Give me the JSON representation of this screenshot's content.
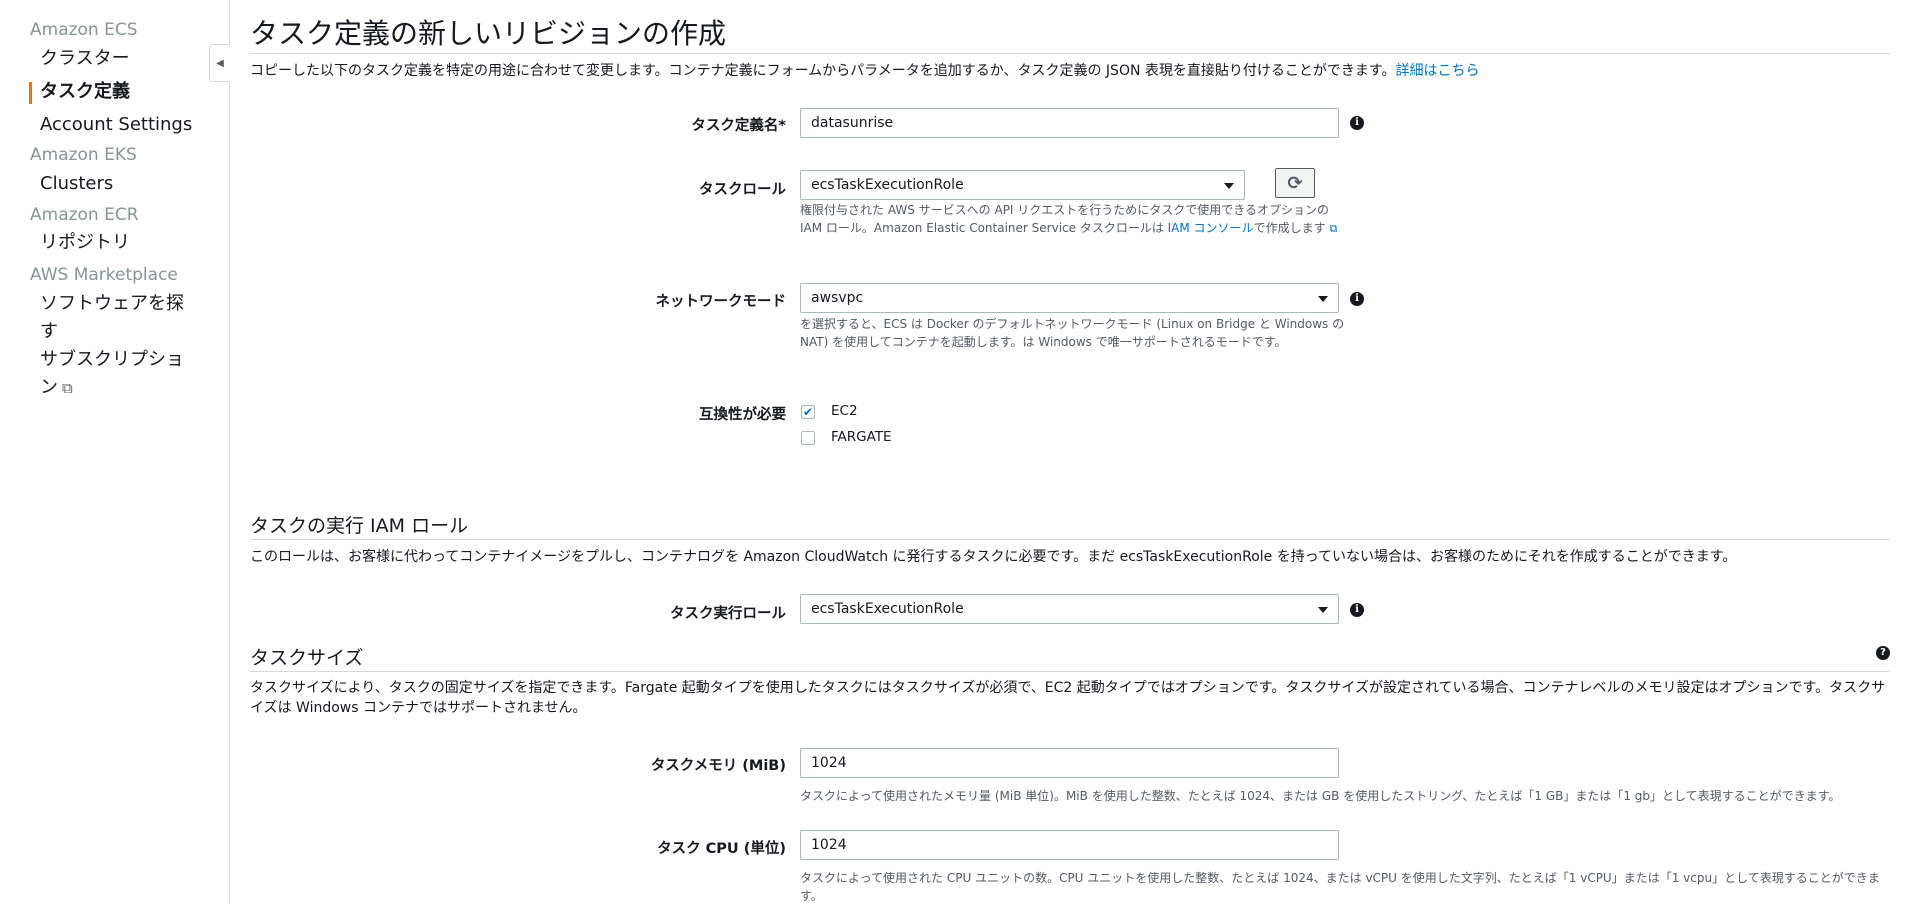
{
  "sidebar": {
    "sections": [
      {
        "title": "Amazon ECS",
        "items": [
          "クラスター",
          "タスク定義",
          "Account Settings"
        ]
      },
      {
        "title": "Amazon EKS",
        "items": [
          "Clusters"
        ]
      },
      {
        "title": "Amazon ECR",
        "items": [
          "リポジトリ"
        ]
      },
      {
        "title": "AWS Marketplace",
        "items": [
          "ソフトウェアを探す",
          "サブスクリプション"
        ]
      }
    ],
    "active_item": "タスク定義"
  },
  "page": {
    "title": "タスク定義の新しいリビジョンの作成",
    "description": "コピーした以下のタスク定義を特定の用途に合わせて変更します。コンテナ定義にフォームからパラメータを追加するか、タスク定義の JSON 表現を直接貼り付けることができます。",
    "learn_more": "詳細はこちら"
  },
  "form": {
    "task_def_name": {
      "label": "タスク定義名*",
      "value": "datasunrise"
    },
    "task_role": {
      "label": "タスクロール",
      "value": "ecsTaskExecutionRole",
      "help_line1": "権限付与された AWS サービスへの API リクエストを行うためにタスクで使用できるオプションの",
      "help_line2_prefix": "IAM ロール。Amazon Elastic Container Service タスクロールは ",
      "help_link": "IAM コンソール",
      "help_line2_suffix": "で作成します"
    },
    "network_mode": {
      "label": "ネットワークモード",
      "value": "awsvpc",
      "help_line1": "を選択すると、ECS は Docker のデフォルトネットワークモード (Linux on Bridge と Windows の",
      "help_line2": "NAT) を使用してコンテナを起動します。は Windows で唯一サポートされるモードです。"
    },
    "compatibility": {
      "label": "互換性が必要",
      "options": [
        {
          "label": "EC2",
          "checked": true
        },
        {
          "label": "FARGATE",
          "checked": false
        }
      ]
    }
  },
  "execution_role": {
    "title": "タスクの実行 IAM ロール",
    "description": "このロールは、お客様に代わってコンテナイメージをプルし、コンテナログを Amazon CloudWatch に発行するタスクに必要です。まだ ecsTaskExecutionRole を持っていない場合は、お客様のためにそれを作成することができます。",
    "label": "タスク実行ロール",
    "value": "ecsTaskExecutionRole"
  },
  "task_size": {
    "title": "タスクサイズ",
    "description_line1": "タスクサイズにより、タスクの固定サイズを指定できます。Fargate 起動タイプを使用したタスクにはタスクサイズが必須で、EC2 起動タイプではオプションです。タスクサイズが設定されている場合、コンテナレベルのメモリ設定はオプションです。タスクサ",
    "description_line2": "イズは Windows コンテナではサポートされません。",
    "memory": {
      "label": "タスクメモリ (MiB)",
      "value": "1024",
      "help": "タスクによって使用されたメモリ量 (MiB 単位)。MiB を使用した整数、たとえば 1024、または GB を使用したストリング、たとえば「1 GB」または「1 gb」として表現することができます。"
    },
    "cpu": {
      "label": "タスク CPU (単位)",
      "value": "1024",
      "help_line1": "タスクによって使用された CPU ユニットの数。CPU ユニットを使用した整数、たとえば 1024、または vCPU を使用した文字列、たとえば「1 vCPU」または「1 vcpu」として表現することができま",
      "help_line2": "す。"
    }
  },
  "colors": {
    "accent": "#ec7211",
    "link": "#0073bb",
    "border": "#aab7b8"
  }
}
